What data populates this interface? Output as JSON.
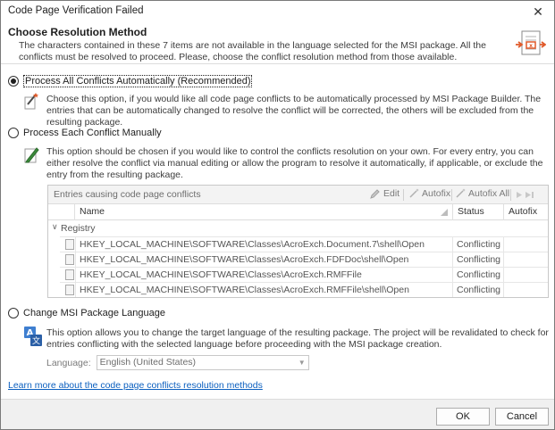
{
  "window": {
    "title": "Code Page Verification Failed",
    "close_glyph": "✕"
  },
  "header": {
    "title": "Choose Resolution Method",
    "description": "The characters contained in these 7 items are not available in the language selected for the MSI package. All the conflicts must be resolved to proceed. Please, choose the conflict resolution method from those available.",
    "icon": "document-conflict-icon"
  },
  "options": [
    {
      "label": "Process All Conflicts Automatically (Recommended)",
      "selected": true,
      "icon": "magic-wand-icon",
      "description": "Choose this option, if you would like all code page conflicts to be automatically processed by MSI Package Builder. The entries that can be automatically changed to resolve the conflict will be corrected, the others will be excluded from the resulting package."
    },
    {
      "label": "Process Each Conflict Manually",
      "selected": false,
      "icon": "pen-icon",
      "description": "This option should be chosen if you would like to control the conflicts resolution on your own. For every entry, you can either resolve the conflict via manual editing or allow the program to resolve it automatically, if applicable, or exclude the entry from the resulting package."
    },
    {
      "label": "Change MSI Package Language",
      "selected": false,
      "icon": "translate-icon",
      "description": "This option allows you to change the target language of the resulting package. The project will be revalidated to check for entries conflicting with the selected language before proceeding with the MSI package creation."
    }
  ],
  "grid": {
    "caption": "Entries causing code page conflicts",
    "toolbar": {
      "edit": "Edit",
      "autofix": "Autofix",
      "autofix_all": "Autofix All"
    },
    "columns": {
      "name": "Name",
      "status": "Status",
      "autofix": "Autofix"
    },
    "group": "Registry",
    "rows": [
      {
        "name": "HKEY_LOCAL_MACHINE\\SOFTWARE\\Classes\\AcroExch.Document.7\\shell\\Open",
        "status": "Conflicting",
        "autofix": ""
      },
      {
        "name": "HKEY_LOCAL_MACHINE\\SOFTWARE\\Classes\\AcroExch.FDFDoc\\shell\\Open",
        "status": "Conflicting",
        "autofix": ""
      },
      {
        "name": "HKEY_LOCAL_MACHINE\\SOFTWARE\\Classes\\AcroExch.RMFFile",
        "status": "Conflicting",
        "autofix": ""
      },
      {
        "name": "HKEY_LOCAL_MACHINE\\SOFTWARE\\Classes\\AcroExch.RMFFile\\shell\\Open",
        "status": "Conflicting",
        "autofix": ""
      }
    ]
  },
  "language": {
    "label": "Language:",
    "value": "English (United States)"
  },
  "learn_more": "Learn more about the code page conflicts resolution methods",
  "buttons": {
    "ok": "OK",
    "cancel": "Cancel"
  },
  "colors": {
    "link": "#0b5fbf",
    "accent": "#e05a2a",
    "disabled_text": "#7a7a7a"
  }
}
